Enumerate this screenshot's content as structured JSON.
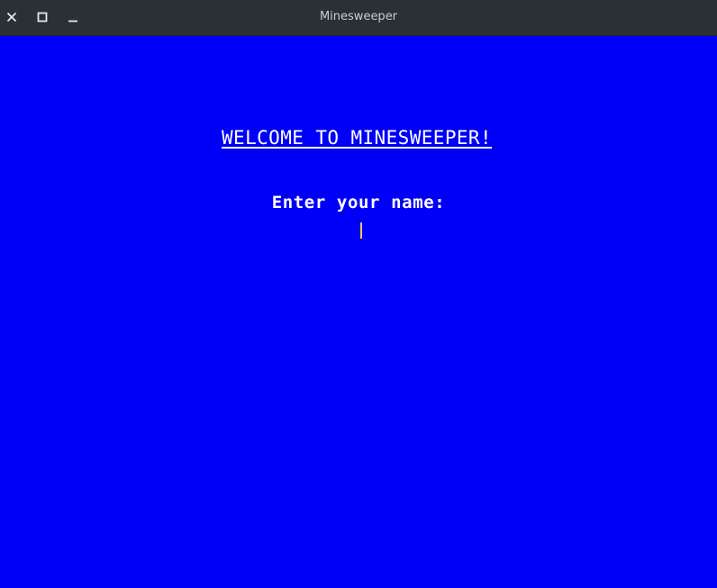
{
  "window": {
    "title": "Minesweeper",
    "controls": [
      "close-icon",
      "maximize-icon",
      "minimize-icon"
    ]
  },
  "screen": {
    "background_color": "#0000f8",
    "heading": "WELCOME TO MINESWEEPER!",
    "prompt": "Enter your name:",
    "name_value": "",
    "caret_color": "#e8c84a"
  }
}
